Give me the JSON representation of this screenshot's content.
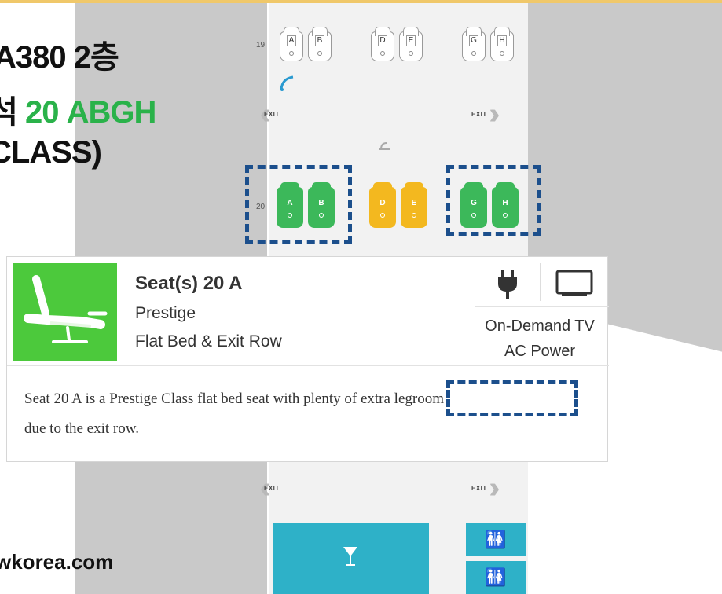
{
  "headline": {
    "line1": "A380 2층",
    "line2_prefix": "l석 ",
    "line2_accent": "20 ABGH",
    "line3": "CLASS)"
  },
  "site": "wkorea.com",
  "seatmap": {
    "row19": {
      "number": "19",
      "seats": [
        "A",
        "B",
        "D",
        "E",
        "G",
        "H"
      ]
    },
    "row20": {
      "number": "20",
      "seats": [
        "A",
        "B",
        "D",
        "E",
        "G",
        "H"
      ]
    },
    "exit_label": "EXIT",
    "colors": {
      "green": "#3cb85a",
      "yellow": "#f3b81f",
      "highlight_dash": "#1c4f8c",
      "facility": "#2eb1c8"
    }
  },
  "card": {
    "title": "Seat(s) 20 A",
    "class": "Prestige",
    "feature": "Flat Bed & Exit Row",
    "amenity_1": "On-Demand TV",
    "amenity_2": "AC Power",
    "description_1": "Seat 20 A is a Prestige Class flat bed seat with plenty of extra legroom",
    "description_2": "due to the exit row.",
    "icons": [
      "power-plug-icon",
      "tv-icon",
      "flat-bed-seat-icon"
    ],
    "accent_color": "#4cc93c"
  },
  "facilities": {
    "bar_icon": "cocktail-glass-icon",
    "lavatory_icon": "lavatory-icon"
  }
}
